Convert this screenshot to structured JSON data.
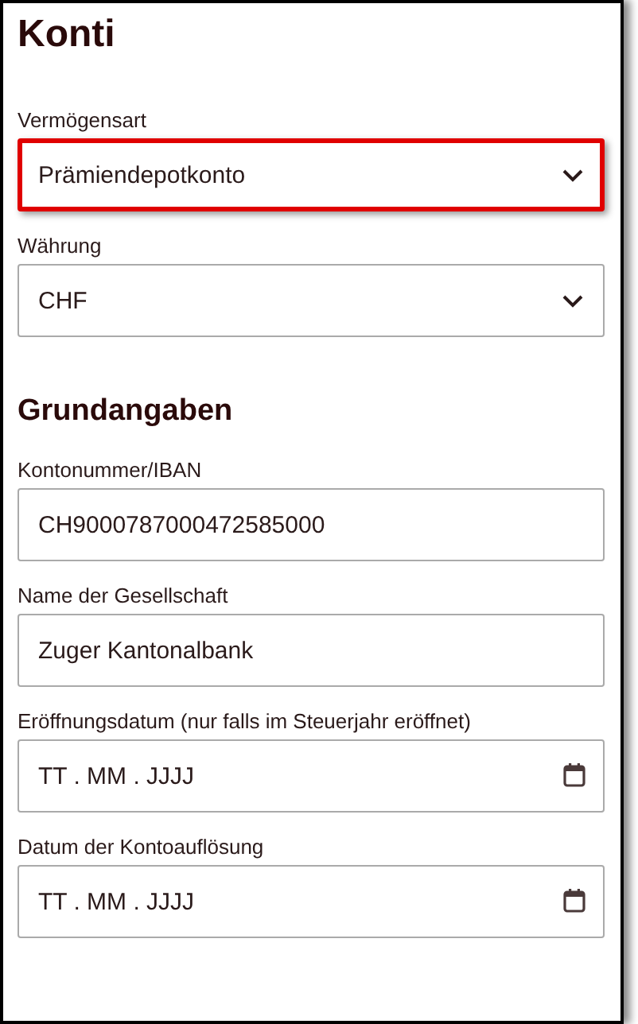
{
  "sections": [
    {
      "title": "Konti",
      "fields": [
        {
          "kind": "select",
          "label": "Vermögensart",
          "value": "Prämiendepotkonto",
          "highlighted": true
        },
        {
          "kind": "select",
          "label": "Währung",
          "value": "CHF",
          "highlighted": false
        }
      ]
    },
    {
      "title": "Grundangaben",
      "fields": [
        {
          "kind": "text",
          "label": "Kontonummer/IBAN",
          "value": "CH9000787000472585000"
        },
        {
          "kind": "text",
          "label": "Name der Gesellschaft",
          "value": "Zuger Kantonalbank"
        },
        {
          "kind": "date",
          "label": "Eröffnungsdatum (nur falls im Steuerjahr eröffnet)",
          "placeholder": "TT . MM . JJJJ"
        },
        {
          "kind": "date",
          "label": "Datum der Kontoauflösung",
          "placeholder": "TT . MM . JJJJ"
        }
      ]
    }
  ]
}
